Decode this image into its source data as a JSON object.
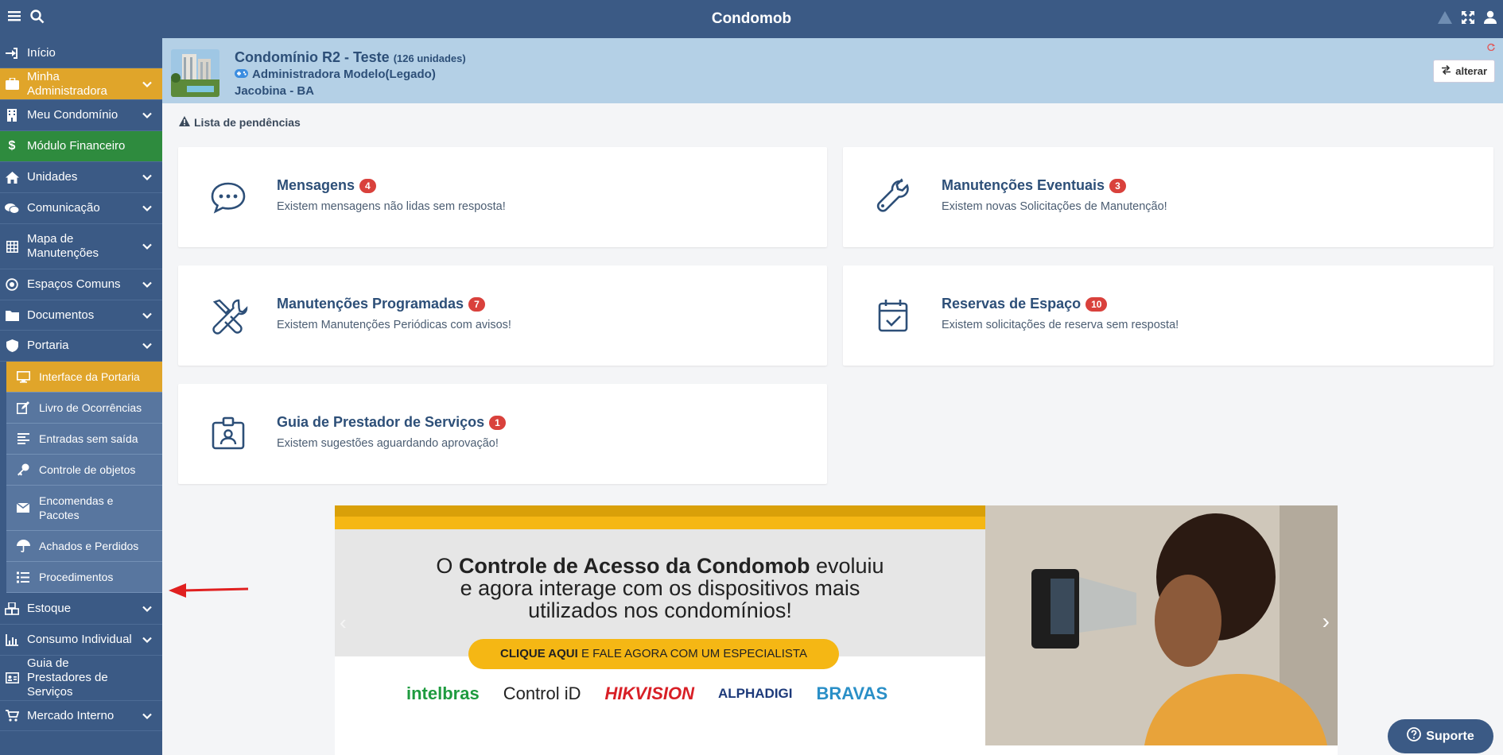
{
  "app": {
    "title": "Condomob"
  },
  "sidebar": {
    "items": [
      {
        "label": "Início",
        "icon": "sign-in-icon"
      },
      {
        "label": "Minha Administradora",
        "icon": "briefcase-icon",
        "state": "active-yellow"
      },
      {
        "label": "Meu Condomínio",
        "icon": "building-icon"
      },
      {
        "label": "Módulo Financeiro",
        "icon": "dollar-icon",
        "state": "active-green"
      },
      {
        "label": "Unidades",
        "icon": "home-icon"
      },
      {
        "label": "Comunicação",
        "icon": "comments-icon"
      },
      {
        "label": "Mapa de Manutenções",
        "icon": "grid-icon"
      },
      {
        "label": "Espaços Comuns",
        "icon": "target-icon"
      },
      {
        "label": "Documentos",
        "icon": "folder-icon"
      },
      {
        "label": "Portaria",
        "icon": "shield-icon"
      },
      {
        "label": "Estoque",
        "icon": "cubes-icon"
      },
      {
        "label": "Consumo Individual",
        "icon": "chart-icon"
      },
      {
        "label": "Guia de Prestadores de Serviços",
        "icon": "id-card-icon"
      },
      {
        "label": "Mercado Interno",
        "icon": "cart-icon"
      }
    ],
    "portaria_sub": [
      {
        "label": "Interface da Portaria",
        "icon": "desktop-icon",
        "state": "active"
      },
      {
        "label": "Livro de Ocorrências",
        "icon": "edit-icon"
      },
      {
        "label": "Entradas sem saída",
        "icon": "align-left-icon"
      },
      {
        "label": "Controle de objetos",
        "icon": "key-icon"
      },
      {
        "label": "Encomendas e Pacotes",
        "icon": "envelope-icon"
      },
      {
        "label": "Achados e Perdidos",
        "icon": "umbrella-icon"
      },
      {
        "label": "Procedimentos",
        "icon": "list-check-icon"
      }
    ]
  },
  "condo": {
    "name": "Condomínio R2 - Teste",
    "units": "(126 unidades)",
    "admin": "Administradora Modelo(Legado)",
    "city": "Jacobina - BA",
    "change_label": "alterar"
  },
  "pending": {
    "title": "Lista de pendências",
    "cards": [
      {
        "title": "Mensagens",
        "count": "4",
        "desc": "Existem mensagens não lidas sem resposta!",
        "icon": "chat-bubble-icon"
      },
      {
        "title": "Manutenções Eventuais",
        "count": "3",
        "desc": "Existem novas Solicitações de Manutenção!",
        "icon": "wrench-icon"
      },
      {
        "title": "Manutenções Programadas",
        "count": "7",
        "desc": "Existem Manutenções Periódicas com avisos!",
        "icon": "tools-icon"
      },
      {
        "title": "Reservas de Espaço",
        "count": "10",
        "desc": "Existem solicitações de reserva sem resposta!",
        "icon": "calendar-check-icon"
      },
      {
        "title": "Guia de Prestador de Serviços",
        "count": "1",
        "desc": "Existem sugestões aguardando aprovação!",
        "icon": "id-badge-icon"
      }
    ]
  },
  "banner": {
    "line1_prefix": "O ",
    "line1_bold": "Controle de Acesso da Condomob",
    "line1_suffix": " evoluiu",
    "line2": "e agora interage com os dispositivos mais",
    "line3": "utilizados nos condomínios!",
    "cta_bold": "CLIQUE AQUI",
    "cta_rest": " E FALE AGORA COM UM ESPECIALISTA",
    "brands": [
      {
        "name": "intelbras",
        "color": "#1e9b3f"
      },
      {
        "name": "Control iD",
        "color": "#222222"
      },
      {
        "name": "HIKVISION",
        "color": "#d81f26"
      },
      {
        "name": "ALPHADIGI",
        "color": "#1d3a7a"
      },
      {
        "name": "BRAVAS",
        "color": "#2a8fc7"
      }
    ]
  },
  "support": {
    "label": "Suporte"
  },
  "colors": {
    "brand": "#3b5a85",
    "active_yellow": "#e0a52a",
    "active_green": "#2e8b3e",
    "badge_red": "#d9413c",
    "header_bg": "#b4d0e6"
  }
}
